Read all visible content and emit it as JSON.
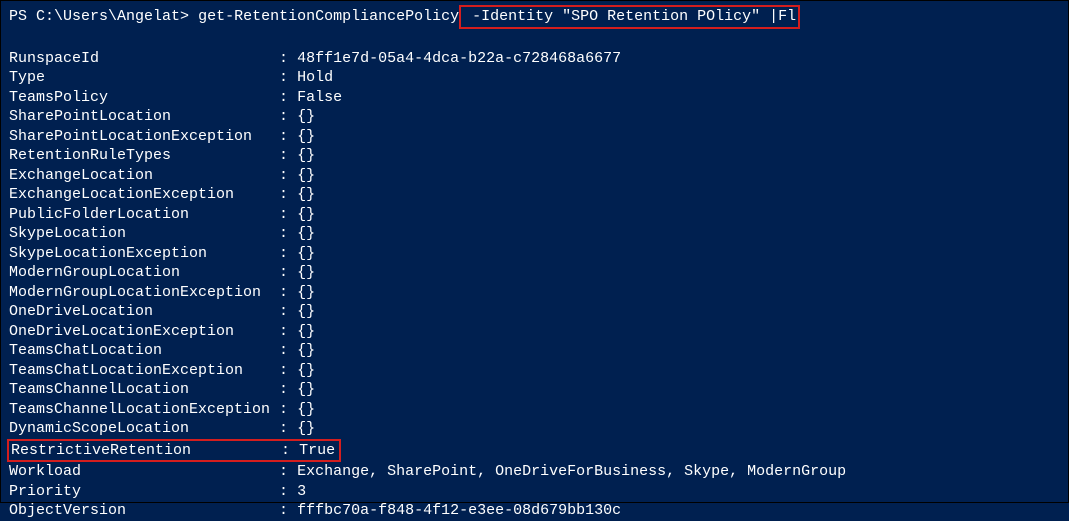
{
  "prompt": {
    "prefix": "PS ",
    "path": "C:\\Users\\Angelat",
    "sep": "> ",
    "cmd_part1": "get-RetentionCompliancePolicy",
    "cmd_part2": " -Identity \"SPO Retention POlicy\" |Fl"
  },
  "properties": [
    {
      "name": "RunspaceId",
      "value": "48ff1e7d-05a4-4dca-b22a-c728468a6677",
      "highlighted": false
    },
    {
      "name": "Type",
      "value": "Hold",
      "highlighted": false
    },
    {
      "name": "TeamsPolicy",
      "value": "False",
      "highlighted": false
    },
    {
      "name": "SharePointLocation",
      "value": "{}",
      "highlighted": false
    },
    {
      "name": "SharePointLocationException",
      "value": "{}",
      "highlighted": false
    },
    {
      "name": "RetentionRuleTypes",
      "value": "{}",
      "highlighted": false
    },
    {
      "name": "ExchangeLocation",
      "value": "{}",
      "highlighted": false
    },
    {
      "name": "ExchangeLocationException",
      "value": "{}",
      "highlighted": false
    },
    {
      "name": "PublicFolderLocation",
      "value": "{}",
      "highlighted": false
    },
    {
      "name": "SkypeLocation",
      "value": "{}",
      "highlighted": false
    },
    {
      "name": "SkypeLocationException",
      "value": "{}",
      "highlighted": false
    },
    {
      "name": "ModernGroupLocation",
      "value": "{}",
      "highlighted": false
    },
    {
      "name": "ModernGroupLocationException",
      "value": "{}",
      "highlighted": false
    },
    {
      "name": "OneDriveLocation",
      "value": "{}",
      "highlighted": false
    },
    {
      "name": "OneDriveLocationException",
      "value": "{}",
      "highlighted": false
    },
    {
      "name": "TeamsChatLocation",
      "value": "{}",
      "highlighted": false
    },
    {
      "name": "TeamsChatLocationException",
      "value": "{}",
      "highlighted": false
    },
    {
      "name": "TeamsChannelLocation",
      "value": "{}",
      "highlighted": false
    },
    {
      "name": "TeamsChannelLocationException",
      "value": "{}",
      "highlighted": false
    },
    {
      "name": "DynamicScopeLocation",
      "value": "{}",
      "highlighted": false
    },
    {
      "name": "RestrictiveRetention",
      "value": "True",
      "highlighted": true
    },
    {
      "name": "Workload",
      "value": "Exchange, SharePoint, OneDriveForBusiness, Skype, ModernGroup",
      "highlighted": false
    },
    {
      "name": "Priority",
      "value": "3",
      "highlighted": false
    },
    {
      "name": "ObjectVersion",
      "value": "fffbc70a-f848-4f12-e3ee-08d679bb130c",
      "highlighted": false
    }
  ]
}
